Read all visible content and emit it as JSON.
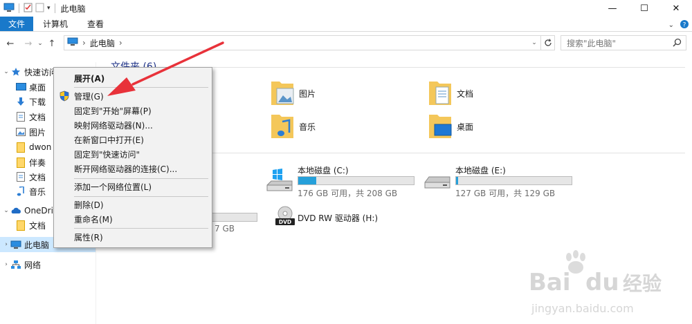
{
  "window": {
    "title": "此电脑",
    "controls": {
      "minimize": "—",
      "maximize": "☐",
      "close": "✕"
    }
  },
  "ribbon": {
    "tabs": [
      {
        "label": "文件",
        "active": true
      },
      {
        "label": "计算机",
        "active": false
      },
      {
        "label": "查看",
        "active": false
      }
    ]
  },
  "address": {
    "path": [
      "此电脑"
    ],
    "search_placeholder": "搜索\"此电脑\""
  },
  "nav": {
    "items": [
      {
        "label": "快速访问",
        "icon": "star-icon"
      },
      {
        "label": "桌面",
        "icon": "desktop-icon"
      },
      {
        "label": "下载",
        "icon": "download-icon"
      },
      {
        "label": "文档",
        "icon": "document-icon"
      },
      {
        "label": "图片",
        "icon": "picture-icon"
      },
      {
        "label": "dwon",
        "icon": "folder-icon"
      },
      {
        "label": "伴奏",
        "icon": "folder-icon"
      },
      {
        "label": "文档",
        "icon": "document-icon"
      },
      {
        "label": "音乐",
        "icon": "music-icon"
      },
      {
        "label": "OneDrive",
        "icon": "cloud-icon"
      },
      {
        "label": "文档",
        "icon": "folder-icon"
      },
      {
        "label": "此电脑",
        "icon": "computer-icon",
        "selected": true
      },
      {
        "label": "网络",
        "icon": "network-icon"
      }
    ]
  },
  "content": {
    "folders_header": "文件夹 (6)",
    "folders": [
      {
        "label": "图片",
        "icon": "picture-folder-icon"
      },
      {
        "label": "文档",
        "icon": "document-folder-icon"
      },
      {
        "label": "音乐",
        "icon": "music-folder-icon"
      },
      {
        "label": "桌面",
        "icon": "desktop-folder-icon"
      }
    ],
    "drives": [
      {
        "name": "本地磁盘 (C:)",
        "free": "176 GB 可用，共 208 GB",
        "used_fraction": 0.154,
        "icon": "windows-drive-icon"
      },
      {
        "name": "本地磁盘 (E:)",
        "free": "127 GB 可用，共 129 GB",
        "used_fraction": 0.016,
        "icon": "drive-icon"
      },
      {
        "name": "DVD RW 驱动器 (H:)",
        "icon": "dvd-drive-icon"
      }
    ],
    "partial_drive_text": "7 GB"
  },
  "context_menu": {
    "items": [
      {
        "label": "展开(A)",
        "bold": true
      },
      {
        "label": "管理(G)",
        "icon": "shield-icon"
      },
      {
        "label": "固定到\"开始\"屏幕(P)"
      },
      {
        "label": "映射网络驱动器(N)..."
      },
      {
        "label": "在新窗口中打开(E)"
      },
      {
        "label": "固定到\"快速访问\""
      },
      {
        "label": "断开网络驱动器的连接(C)..."
      },
      {
        "label": "添加一个网络位置(L)"
      },
      {
        "label": "删除(D)"
      },
      {
        "label": "重命名(M)"
      },
      {
        "label": "属性(R)"
      }
    ]
  },
  "colors": {
    "accent": "#1979ca",
    "selection": "#cce8ff",
    "drive_bar": "#26a0da",
    "annotation_arrow": "#e8323a"
  }
}
